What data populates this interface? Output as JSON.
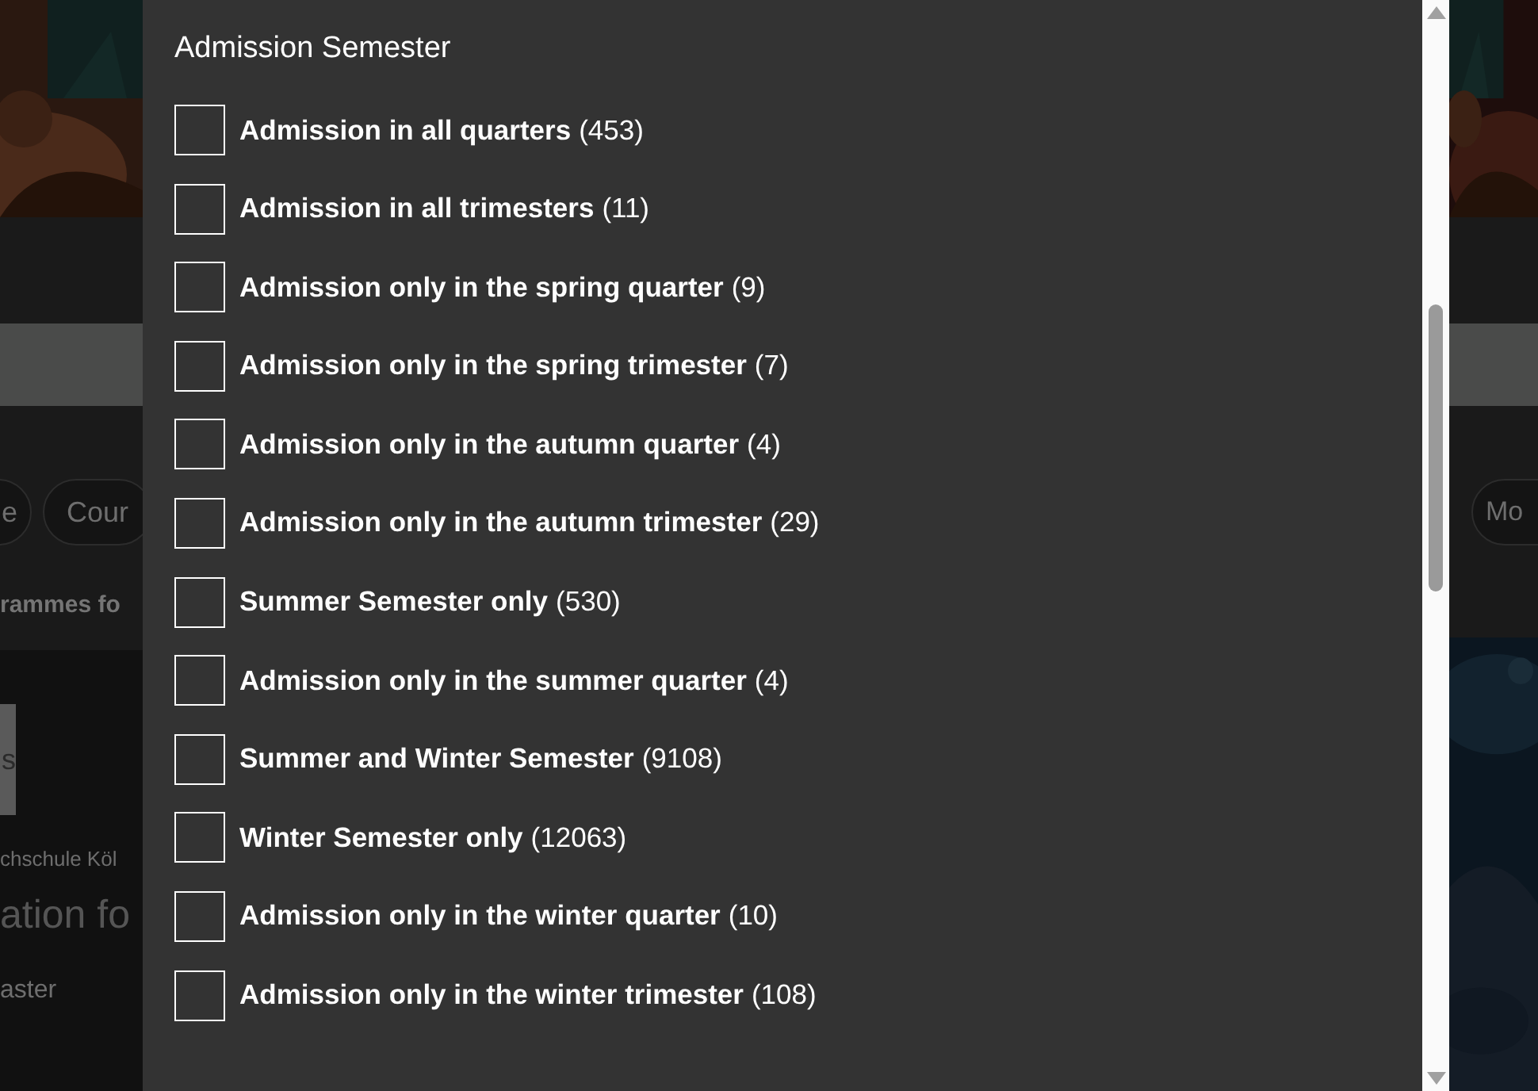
{
  "background_left": {
    "chips": [
      "e",
      "Cour"
    ],
    "heading": "rammes fo",
    "button": "s",
    "institution": "chschule Köl",
    "title": "ation fo",
    "degree": "aster"
  },
  "background_right": {
    "chips": [
      "Mo"
    ]
  },
  "dialog": {
    "title": "Admission Semester",
    "options": [
      {
        "label": "Admission in all quarters",
        "count": "(453)",
        "checked": false
      },
      {
        "label": "Admission in all trimesters",
        "count": "(11)",
        "checked": false
      },
      {
        "label": "Admission only in the spring quarter",
        "count": "(9)",
        "checked": false
      },
      {
        "label": "Admission only in the spring trimester",
        "count": "(7)",
        "checked": false
      },
      {
        "label": "Admission only in the autumn quarter",
        "count": "(4)",
        "checked": false
      },
      {
        "label": "Admission only in the autumn trimester",
        "count": "(29)",
        "checked": false
      },
      {
        "label": "Summer Semester only",
        "count": "(530)",
        "checked": false
      },
      {
        "label": "Admission only in the summer quarter",
        "count": "(4)",
        "checked": false
      },
      {
        "label": "Summer and Winter Semester",
        "count": "(9108)",
        "checked": false
      },
      {
        "label": "Winter Semester only",
        "count": "(12063)",
        "checked": false
      },
      {
        "label": "Admission only in the winter quarter",
        "count": "(10)",
        "checked": false
      },
      {
        "label": "Admission only in the winter trimester",
        "count": "(108)",
        "checked": false
      }
    ]
  }
}
